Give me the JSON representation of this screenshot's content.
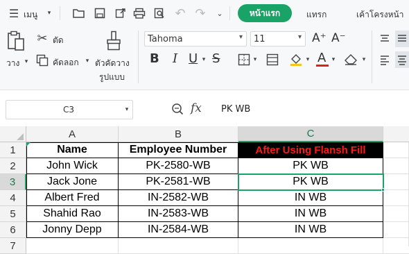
{
  "menubar": {
    "menu_label": "เมนู",
    "tabs": [
      "หน้าแรก",
      "แทรก",
      "เค้าโครงหน้า"
    ]
  },
  "ribbon": {
    "cut_label": "ตัด",
    "paste_label": "วาง",
    "copy_label": "คัดลอก",
    "format_painter_line1": "ตัวคัดวาง",
    "format_painter_line2": "รูปแบบ",
    "font_name": "Tahoma",
    "font_size": "11",
    "font_grow": "A⁺",
    "font_shrink": "A⁻",
    "bold": "B",
    "italic": "I",
    "underline": "U",
    "strike": "S",
    "font_color_letter": "A",
    "font_color": "#e02020",
    "fill_color": "#f5c518"
  },
  "formula_bar": {
    "name_box": "C3",
    "fx_label": "fx",
    "formula": "PK WB"
  },
  "sheet": {
    "columns": [
      "A",
      "B",
      "C"
    ],
    "rows": [
      "1",
      "2",
      "3",
      "4",
      "5",
      "6",
      "7"
    ],
    "headers": [
      "Name",
      "Employee Number",
      "After Using Flansh Fill"
    ],
    "data": [
      [
        "John Wick",
        "PK-2580-WB",
        "PK WB"
      ],
      [
        "Jack Jone",
        "PK-2581-WB",
        "PK WB"
      ],
      [
        "Albert Fred",
        "IN-2582-WB",
        "IN WB"
      ],
      [
        "Shahid Rao",
        "IN-2583-WB",
        "IN WB"
      ],
      [
        "Jonny Depp",
        "IN-2584-WB",
        "IN WB"
      ]
    ],
    "selected_cell": "C3",
    "accent_color": "#1aa366"
  }
}
